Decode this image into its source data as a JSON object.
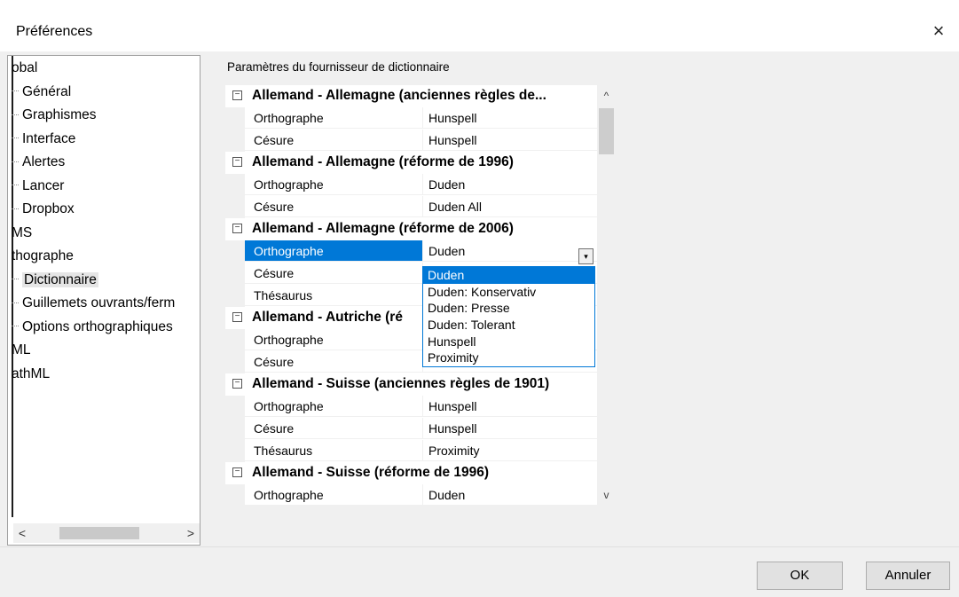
{
  "window": {
    "title": "Préférences",
    "close_glyph": "×"
  },
  "tree": {
    "items": [
      {
        "label": "obal",
        "level": 0
      },
      {
        "label": "Général",
        "level": 1
      },
      {
        "label": "Graphismes",
        "level": 1
      },
      {
        "label": "Interface",
        "level": 1
      },
      {
        "label": "Alertes",
        "level": 1
      },
      {
        "label": "Lancer",
        "level": 1
      },
      {
        "label": "Dropbox",
        "level": 1
      },
      {
        "label": "MS",
        "level": 0
      },
      {
        "label": "thographe",
        "level": 0
      },
      {
        "label": "Dictionnaire",
        "level": 1,
        "selected": true
      },
      {
        "label": "Guillemets ouvrants/ferm",
        "level": 1
      },
      {
        "label": "Options orthographiques",
        "level": 1
      },
      {
        "label": "ML",
        "level": 0
      },
      {
        "label": "athML",
        "level": 0
      }
    ],
    "scroll_left_glyph": "<",
    "scroll_right_glyph": ">"
  },
  "panel": {
    "group_label": "Paramètres du fournisseur de dictionnaire"
  },
  "grid": {
    "collapse_glyph": "−",
    "rows": [
      {
        "type": "cat",
        "label": "Allemand - Allemagne (anciennes règles de..."
      },
      {
        "type": "prop",
        "name": "Orthographe",
        "value": "Hunspell"
      },
      {
        "type": "prop",
        "name": "Césure",
        "value": "Hunspell"
      },
      {
        "type": "cat",
        "label": "Allemand - Allemagne (réforme de 1996)"
      },
      {
        "type": "prop",
        "name": "Orthographe",
        "value": "Duden"
      },
      {
        "type": "prop",
        "name": "Césure",
        "value": "Duden All"
      },
      {
        "type": "cat",
        "label": "Allemand - Allemagne (réforme de 2006)"
      },
      {
        "type": "prop",
        "name": "Orthographe",
        "value": "Duden",
        "selected": true
      },
      {
        "type": "prop",
        "name": "Césure",
        "value": ""
      },
      {
        "type": "prop",
        "name": "Thésaurus",
        "value": ""
      },
      {
        "type": "cat",
        "label": "Allemand - Autriche (ré"
      },
      {
        "type": "prop",
        "name": "Orthographe",
        "value": ""
      },
      {
        "type": "prop",
        "name": "Césure",
        "value": ""
      },
      {
        "type": "cat",
        "label": "Allemand - Suisse (anciennes règles de 1901)"
      },
      {
        "type": "prop",
        "name": "Orthographe",
        "value": "Hunspell"
      },
      {
        "type": "prop",
        "name": "Césure",
        "value": "Hunspell"
      },
      {
        "type": "prop",
        "name": "Thésaurus",
        "value": "Proximity"
      },
      {
        "type": "cat",
        "label": "Allemand - Suisse (réforme de 1996)"
      },
      {
        "type": "prop",
        "name": "Orthographe",
        "value": "Duden"
      }
    ],
    "scroll_up_glyph": "^",
    "scroll_down_glyph": "v"
  },
  "dropdown": {
    "button_glyph": "▾",
    "options": [
      "Duden",
      "Duden: Konservativ",
      "Duden: Presse",
      "Duden: Tolerant",
      "Hunspell",
      "Proximity"
    ],
    "highlighted": "Duden"
  },
  "buttons": {
    "ok": "OK",
    "cancel": "Annuler"
  },
  "colors": {
    "accent": "#0078d7",
    "dialog_bg": "#f0f0f0"
  }
}
